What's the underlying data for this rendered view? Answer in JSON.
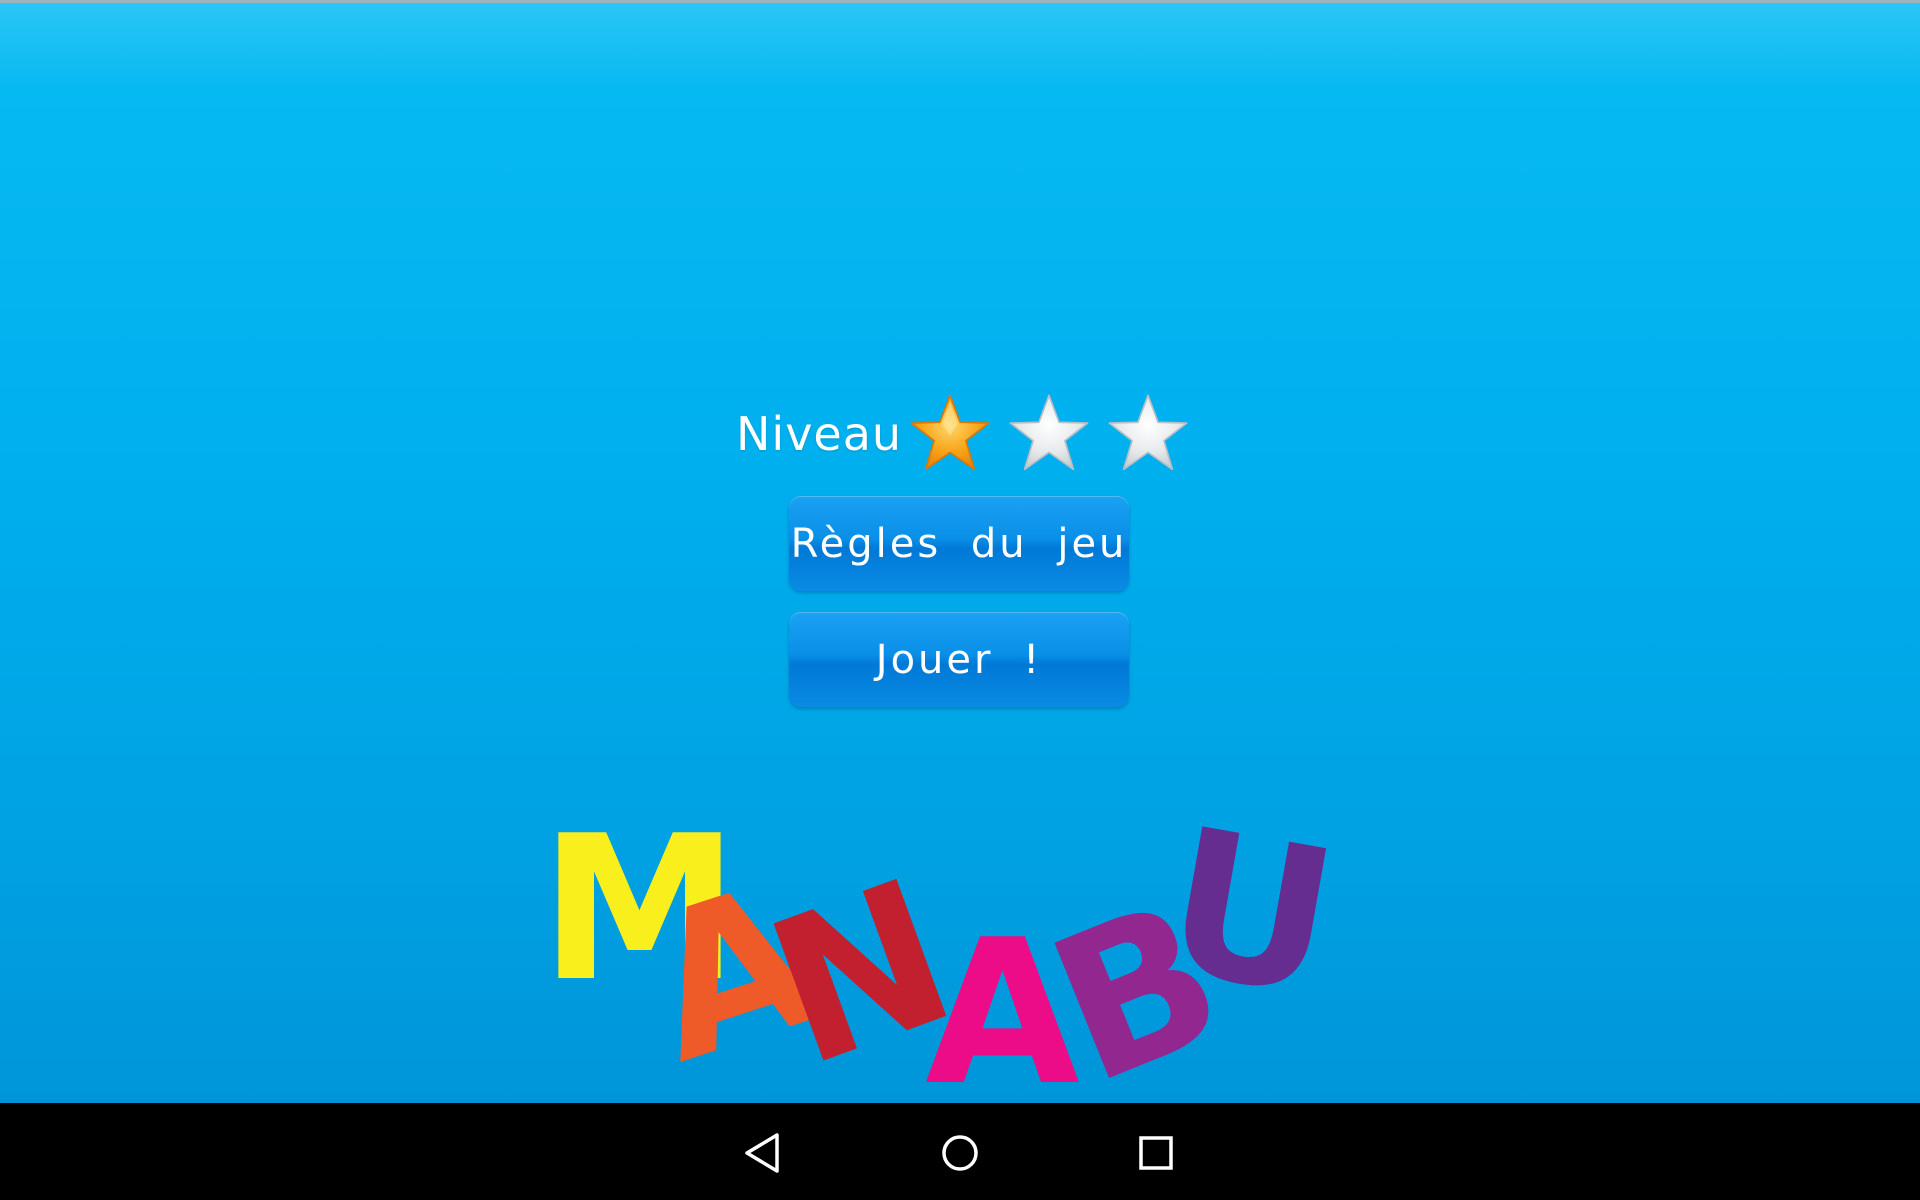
{
  "level": {
    "label": "Niveau",
    "stars_total": 3,
    "stars_selected": 1,
    "stars": [
      {
        "name": "star-icon-1",
        "state": "selected",
        "color": "#f7a21a"
      },
      {
        "name": "star-icon-2",
        "state": "unselected",
        "color": "#e9ecee"
      },
      {
        "name": "star-icon-3",
        "state": "unselected",
        "color": "#e9ecee"
      }
    ]
  },
  "buttons": {
    "rules_label": "Règles du jeu",
    "play_label": "Jouer !"
  },
  "logo": {
    "text": "MANABU",
    "letter_colors": [
      "#f8ef1c",
      "#ef5a29",
      "#c2202f",
      "#ec0c87",
      "#92278f",
      "#662d91"
    ]
  },
  "navbar": {
    "back_icon": "back-triangle-icon",
    "home_icon": "home-circle-icon",
    "recents_icon": "recents-square-icon"
  },
  "colors": {
    "background_top": "#2cc6f6",
    "background_bottom": "#0095d9",
    "button": "#0a8fe8",
    "navbar": "#000000"
  }
}
